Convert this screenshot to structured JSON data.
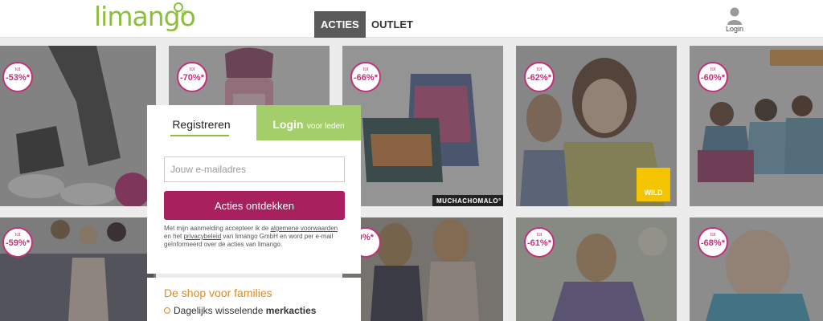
{
  "header": {
    "logo_text": "limango",
    "nav": [
      {
        "label": "ACTIES",
        "active": true
      },
      {
        "label": "OUTLET",
        "active": false
      }
    ],
    "login_label": "Login"
  },
  "tiles": [
    {
      "badge_top": "tot",
      "badge_value": "-53%*"
    },
    {
      "badge_top": "tot",
      "badge_value": "-70%*"
    },
    {
      "badge_top": "tot",
      "badge_value": "-66%*",
      "brand": "MUCHACHOMALO°"
    },
    {
      "badge_top": "tot",
      "badge_value": "-62%*",
      "brand": "WILD"
    },
    {
      "badge_top": "tot",
      "badge_value": "-60%*"
    },
    {
      "badge_top": "tot",
      "badge_value": "-59%*"
    },
    {
      "badge_top": "",
      "badge_value": "0%*"
    },
    {
      "badge_top": "tot",
      "badge_value": "-61%*"
    },
    {
      "badge_top": "tot",
      "badge_value": "-68%*"
    }
  ],
  "register": {
    "tab_register": "Registreren",
    "tab_login_main": "Login",
    "tab_login_sub": "voor leden",
    "email_placeholder": "Jouw e-mailadres",
    "cta_label": "Acties ontdekken",
    "terms_1": "Met mijn aanmelding accepteer ik de ",
    "terms_link_1": "algemene voorwaarden",
    "terms_2": " en het ",
    "terms_link_2": "privacybeleid",
    "terms_3": " van limango GmbH en word per e-mail geïnformeerd over de acties van limango."
  },
  "families": {
    "title": "De shop voor families",
    "item_prefix": "Dagelijks wisselende ",
    "item_bold": "merkacties"
  },
  "colors": {
    "brand_green": "#8dbf3e",
    "cta_magenta": "#a8205e",
    "badge_pink": "#c2307a",
    "accent_orange": "#e08a1e"
  }
}
